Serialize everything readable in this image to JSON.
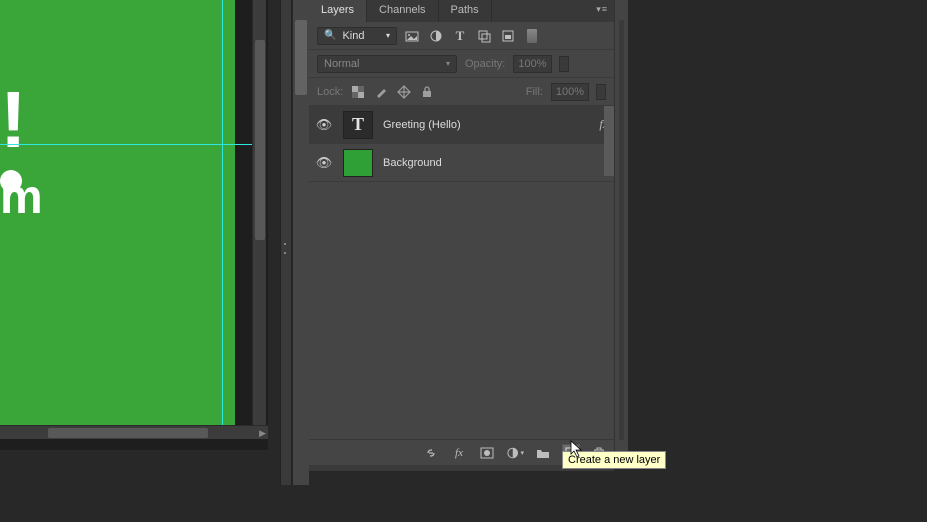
{
  "tabs": {
    "layers": "Layers",
    "channels": "Channels",
    "paths": "Paths"
  },
  "filter": {
    "kind_label": "Kind"
  },
  "blend": {
    "mode": "Normal",
    "opacity_label": "Opacity:",
    "opacity_value": "100%"
  },
  "lock": {
    "label": "Lock:",
    "fill_label": "Fill:",
    "fill_value": "100%"
  },
  "layers": [
    {
      "name": "Greeting (Hello)",
      "type": "text",
      "visible": true,
      "fx": true
    },
    {
      "name": "Background",
      "type": "raster",
      "visible": true,
      "fx": false
    }
  ],
  "tooltip": "Create a new layer",
  "canvas_text": {
    "line1": "!",
    "line2": "m"
  }
}
